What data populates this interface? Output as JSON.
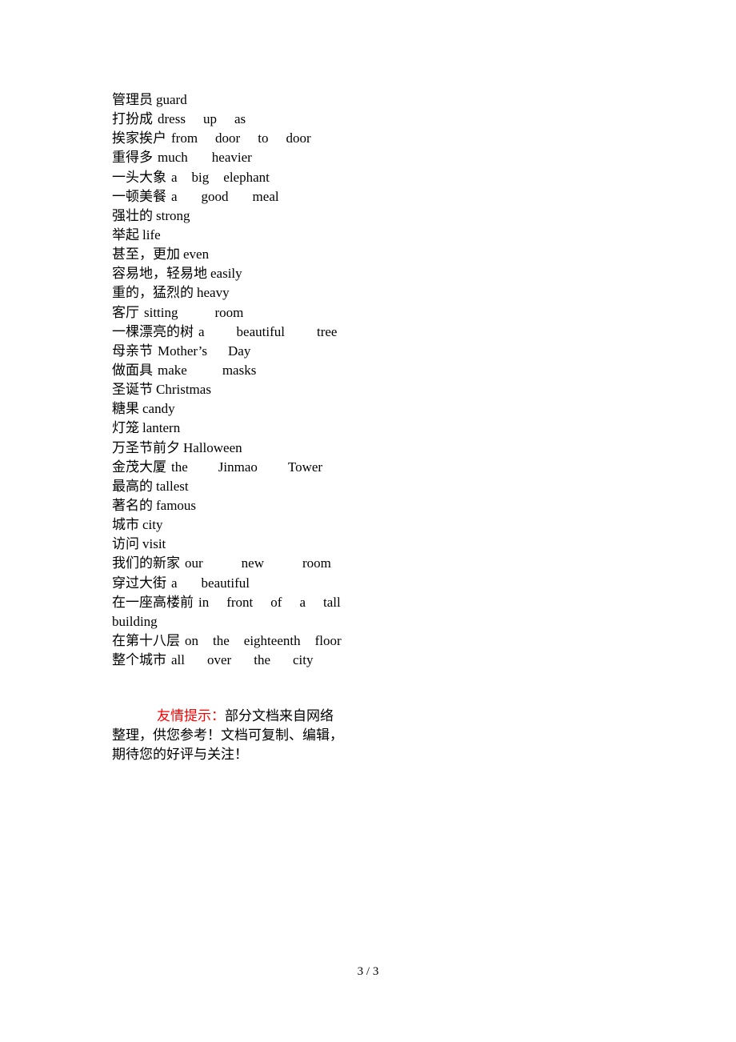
{
  "vocabulary": [
    {
      "cn": "管理员",
      "en": [
        "guard"
      ]
    },
    {
      "cn": "打扮成",
      "en": [
        "dress",
        "up",
        "as"
      ]
    },
    {
      "cn": "挨家挨户",
      "en": [
        "from",
        "door",
        "to",
        "door"
      ]
    },
    {
      "cn": "重得多",
      "en": [
        "much",
        "heavier"
      ]
    },
    {
      "cn": "一头大象",
      "en": [
        "a",
        "big",
        "elephant"
      ]
    },
    {
      "cn": "一顿美餐",
      "en": [
        "a",
        "good",
        "meal"
      ]
    },
    {
      "cn": "强壮的",
      "en": [
        "strong"
      ]
    },
    {
      "cn": "举起",
      "en": [
        "life"
      ]
    },
    {
      "cn": "甚至，更加",
      "en": [
        "even"
      ]
    },
    {
      "cn": "容易地，轻易地",
      "en": [
        "easily"
      ]
    },
    {
      "cn": "重的，猛烈的",
      "en": [
        "heavy"
      ]
    },
    {
      "cn": "客厅",
      "en": [
        "sitting",
        "room"
      ]
    },
    {
      "cn": "一棵漂亮的树",
      "en": [
        "a",
        "beautiful",
        "tree"
      ]
    },
    {
      "cn": "母亲节",
      "en": [
        "Mother’s",
        "Day"
      ]
    },
    {
      "cn": "做面具",
      "en": [
        "make",
        "masks"
      ]
    },
    {
      "cn": "圣诞节",
      "en": [
        "Christmas"
      ]
    },
    {
      "cn": "糖果",
      "en": [
        "candy"
      ]
    },
    {
      "cn": "灯笼",
      "en": [
        "lantern"
      ]
    },
    {
      "cn": "万圣节前夕",
      "en": [
        "Halloween"
      ]
    },
    {
      "cn": "金茂大厦",
      "en": [
        "the",
        "Jinmao",
        "Tower"
      ]
    },
    {
      "cn": "最高的",
      "en": [
        "tallest"
      ]
    },
    {
      "cn": "著名的",
      "en": [
        "famous"
      ]
    },
    {
      "cn": "城市",
      "en": [
        "city"
      ]
    },
    {
      "cn": "访问",
      "en": [
        "visit"
      ]
    },
    {
      "cn": "我们的新家",
      "en": [
        "our",
        "new",
        "room"
      ]
    },
    {
      "cn": "穿过大街",
      "en": [
        "a",
        "beautiful"
      ]
    },
    {
      "cn": "在一座高楼前",
      "en": [
        "in",
        "front",
        "of",
        "a",
        "tall"
      ],
      "continuation": "building"
    },
    {
      "cn": "在第十八层",
      "en": [
        "on",
        "the",
        "eighteenth",
        "floor"
      ]
    },
    {
      "cn": "整个城市",
      "en": [
        "all",
        "over",
        "the",
        "city"
      ]
    }
  ],
  "notice": {
    "label": "友情提示：",
    "line1": "部分文档来自网络",
    "rest": "整理，供您参考！文档可复制、编辑，期待您的好评与关注！",
    "rest_line1": "整理，供您参考！文档可复制、编辑，",
    "rest_line2": "期待您的好评与关注！",
    "label_color": "#ff0000"
  },
  "page_number": "3 / 3"
}
